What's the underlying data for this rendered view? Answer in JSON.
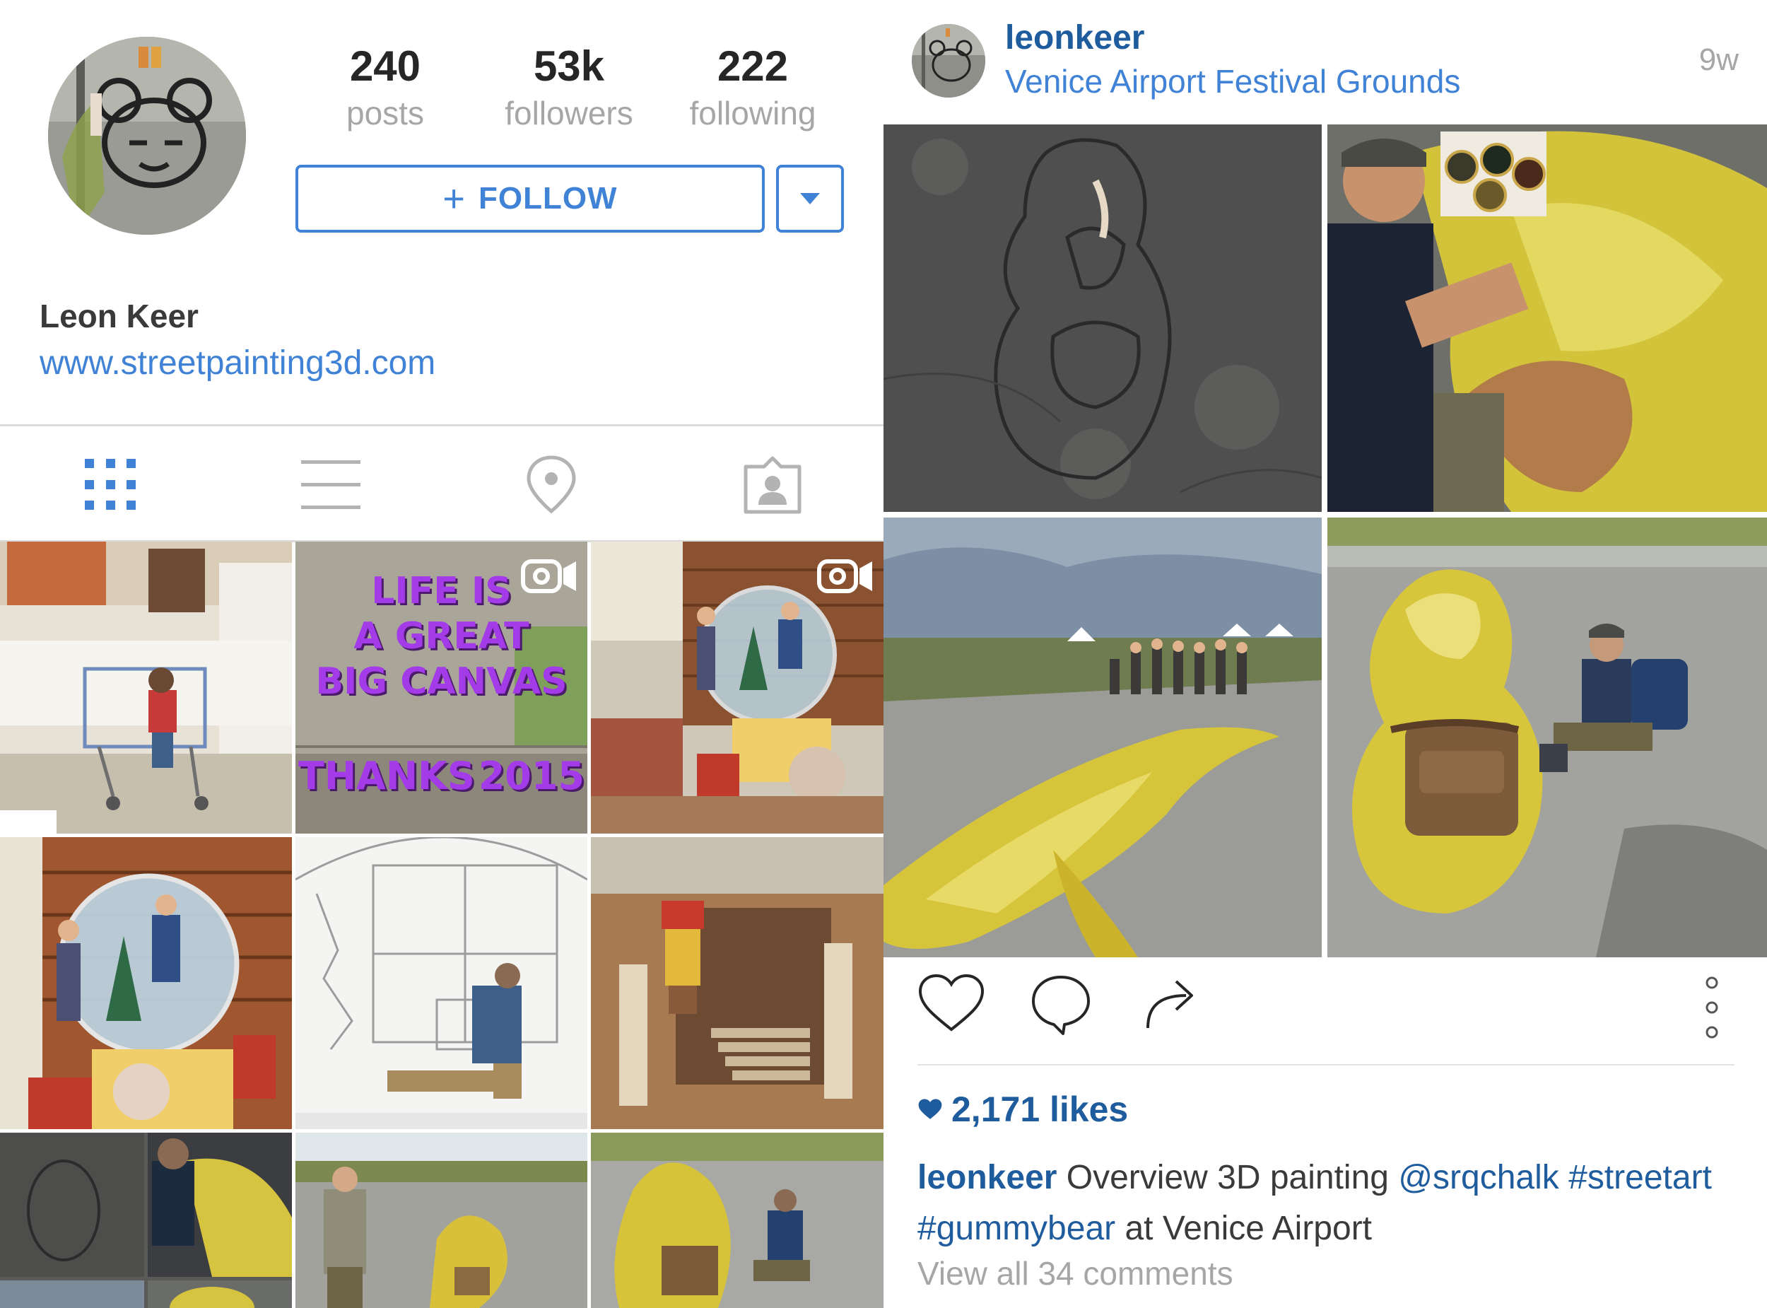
{
  "profile": {
    "stats": {
      "posts": {
        "value": "240",
        "label": "posts"
      },
      "followers": {
        "value": "53k",
        "label": "followers"
      },
      "following": {
        "value": "222",
        "label": "following"
      }
    },
    "follow_button": {
      "icon": "+",
      "label": "FOLLOW"
    },
    "full_name": "Leon Keer",
    "website": "www.streetpainting3d.com",
    "tabs": [
      {
        "name": "grid",
        "icon": "grid-icon",
        "active": true
      },
      {
        "name": "list",
        "icon": "list-icon",
        "active": false
      },
      {
        "name": "places",
        "icon": "location-pin-icon",
        "active": false
      },
      {
        "name": "tagged",
        "icon": "tagged-person-icon",
        "active": false
      }
    ],
    "grid_tiles": [
      {
        "subject": "toddler with shopping cart in room",
        "video": false
      },
      {
        "text_lines": [
          "LIFE IS",
          "A GREAT",
          "BIG CANVAS",
          "THANKS",
          "2015"
        ],
        "video": true
      },
      {
        "subject": "snow globe street painting",
        "video": true
      },
      {
        "subject": "snow globe painting close-up",
        "video": false
      },
      {
        "subject": "sketch with man sitting",
        "video": false
      },
      {
        "subject": "lego figure ancient ruins",
        "video": false
      },
      {
        "subject": "gummy bear collage",
        "video": false
      },
      {
        "subject": "man standing near gummy bear",
        "video": false
      },
      {
        "subject": "gummy bear with backpack",
        "video": false
      }
    ]
  },
  "post": {
    "username": "leonkeer",
    "location": "Venice Airport Festival Grounds",
    "time_ago": "9w",
    "likes": "2,171 likes",
    "caption": {
      "username": "leonkeer",
      "text_before": " Overview 3D painting ",
      "mention": "@srqchalk",
      "hashtag1": "#streetart",
      "hashtag2": "#gummybear",
      "text_after": " at Venice Airport"
    },
    "view_comments": "View all 34 comments"
  },
  "colors": {
    "accent_blue": "#3f82d6",
    "username_blue": "#1f5c9e",
    "muted_gray": "#a6a6a6",
    "divider": "#dbdbdb"
  }
}
